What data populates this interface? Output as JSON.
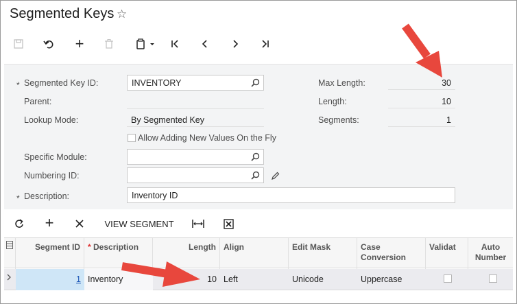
{
  "page": {
    "title": "Segmented Keys"
  },
  "form": {
    "segmented_key_id": {
      "label": "Segmented Key ID:",
      "value": "INVENTORY"
    },
    "parent": {
      "label": "Parent:",
      "value": ""
    },
    "lookup_mode": {
      "label": "Lookup Mode:",
      "value": "By Segmented Key"
    },
    "allow_adding": {
      "label": "Allow Adding New Values On the Fly",
      "checked": false
    },
    "specific_module": {
      "label": "Specific Module:",
      "value": ""
    },
    "numbering_id": {
      "label": "Numbering ID:",
      "value": ""
    },
    "description": {
      "label": "Description:",
      "value": "Inventory ID"
    },
    "max_length": {
      "label": "Max Length:",
      "value": "30"
    },
    "length": {
      "label": "Length:",
      "value": "10"
    },
    "segments": {
      "label": "Segments:",
      "value": "1"
    }
  },
  "grid_toolbar": {
    "view_segment": "VIEW SEGMENT"
  },
  "grid": {
    "columns": [
      "Segment ID",
      "Description",
      "Length",
      "Align",
      "Edit Mask",
      "Case Conversion",
      "Validat",
      "Auto Number"
    ],
    "rows": [
      {
        "segment_id": "1",
        "description": "Inventory",
        "length": "10",
        "align": "Left",
        "edit_mask": "Unicode",
        "case_conversion": "Uppercase",
        "validate": false,
        "auto_number": false
      }
    ]
  },
  "colors": {
    "arrow": "#e8473d",
    "link": "#1a55b5",
    "selected_cell": "#cfe6f7"
  }
}
